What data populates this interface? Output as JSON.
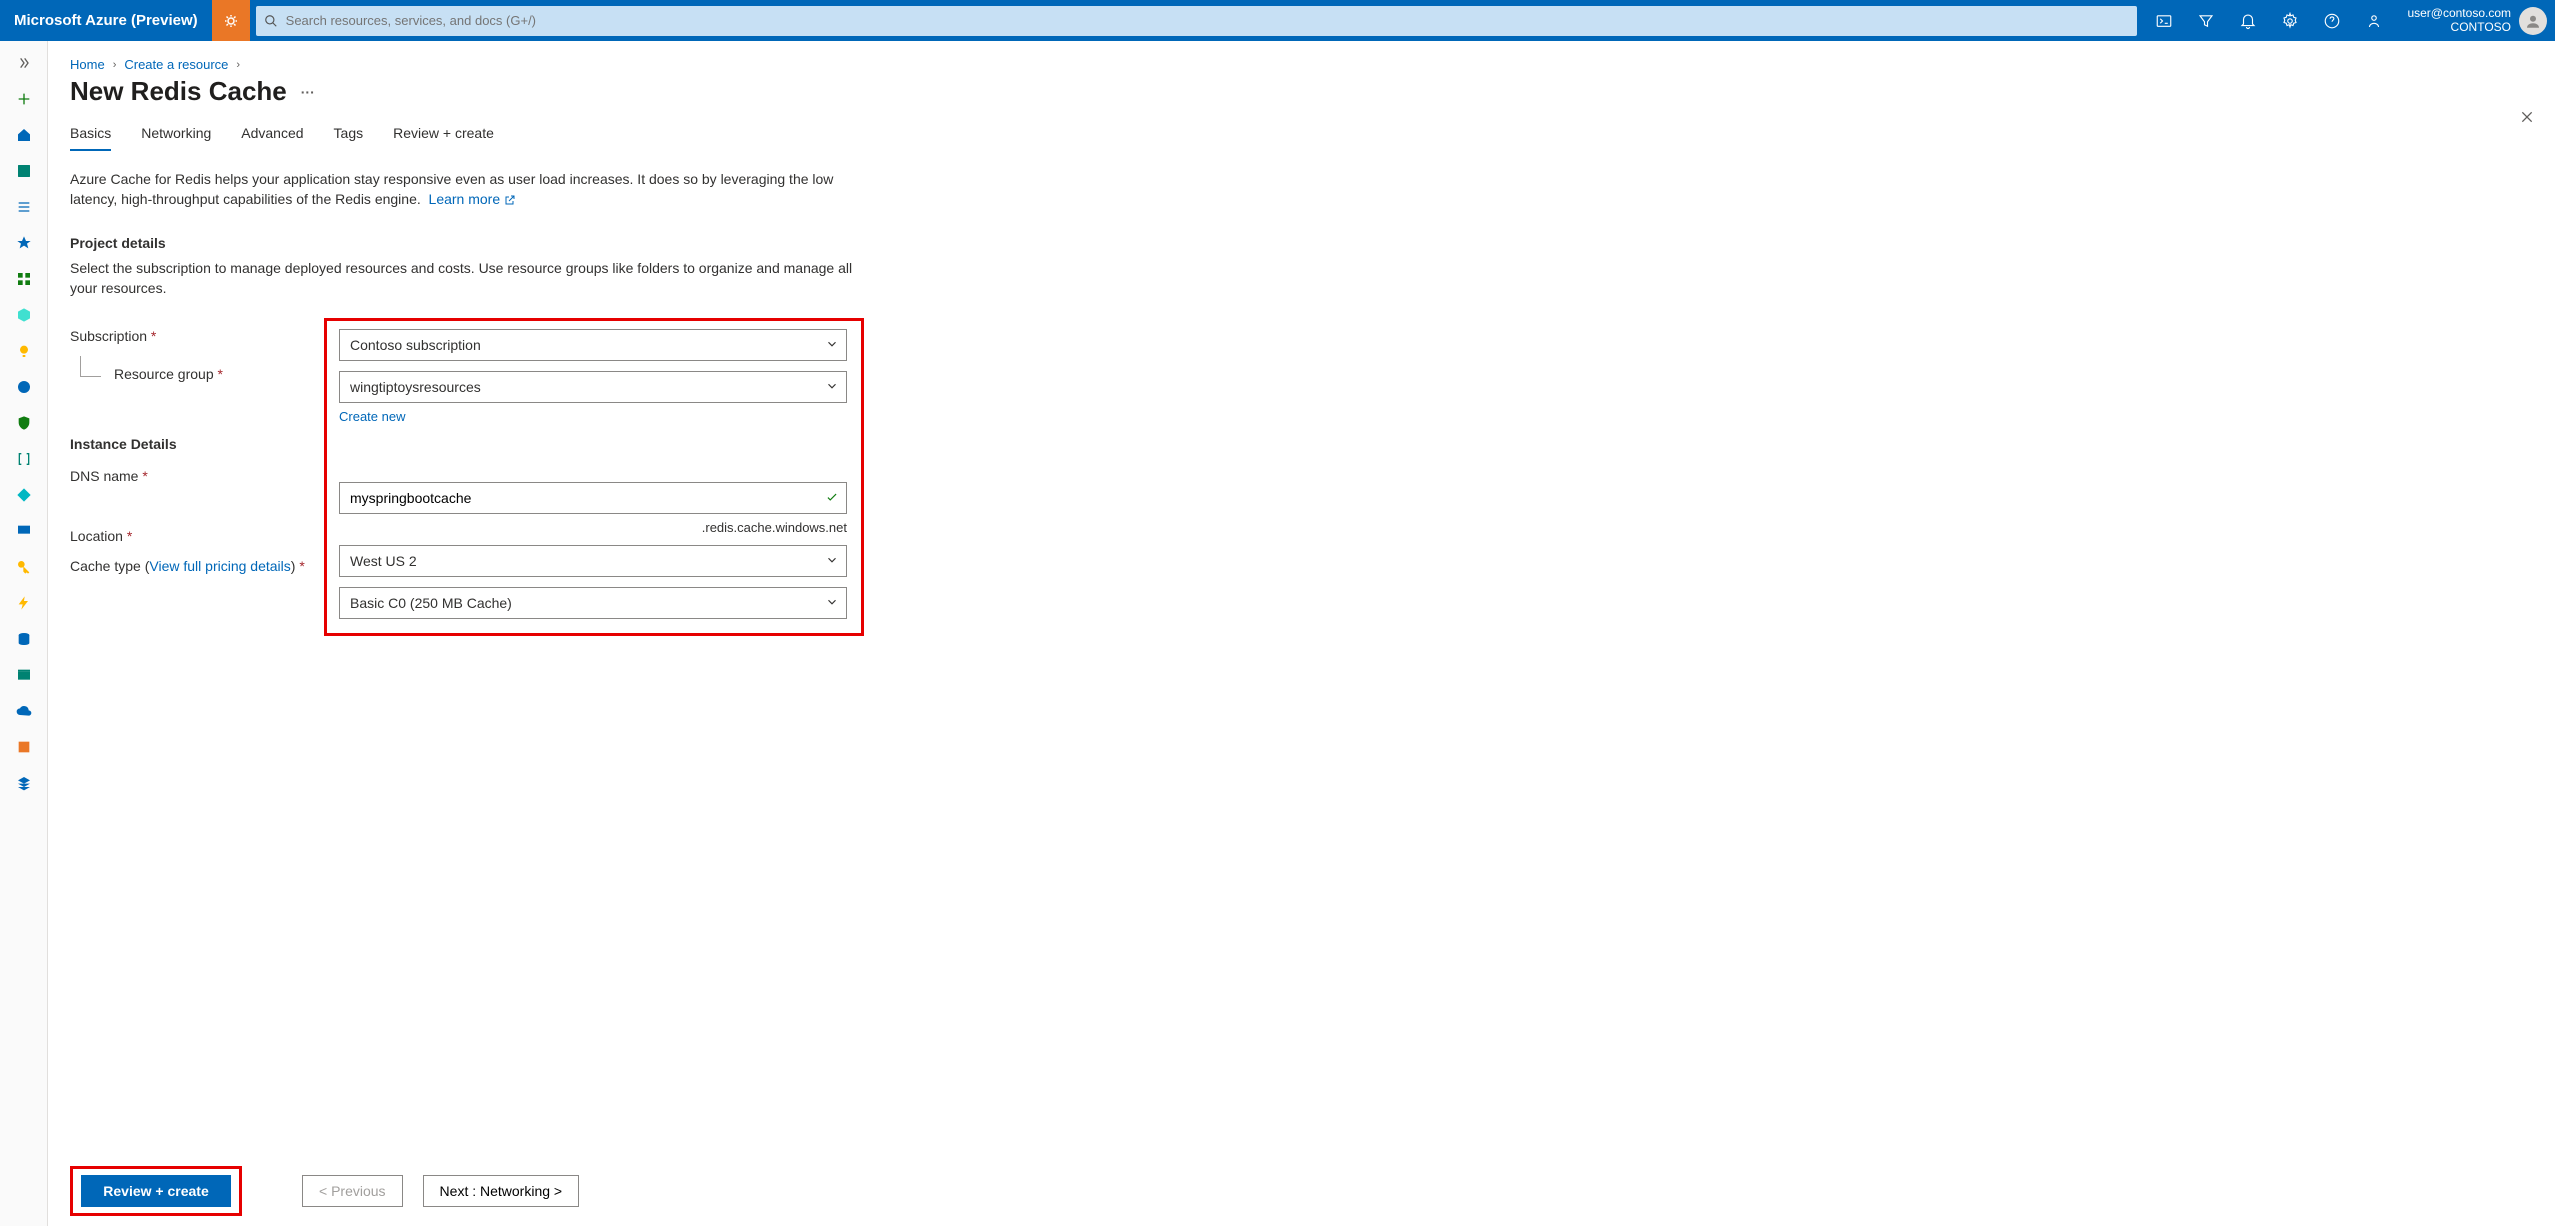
{
  "header": {
    "brand": "Microsoft Azure (Preview)",
    "search_placeholder": "Search resources, services, and docs (G+/)",
    "user_email": "user@contoso.com",
    "tenant": "CONTOSO"
  },
  "breadcrumb": {
    "home": "Home",
    "create": "Create a resource"
  },
  "page": {
    "title": "New Redis Cache",
    "more": "···"
  },
  "tabs": {
    "basics": "Basics",
    "networking": "Networking",
    "advanced": "Advanced",
    "tags": "Tags",
    "review": "Review + create"
  },
  "intro": {
    "text": "Azure Cache for Redis helps your application stay responsive even as user load increases. It does so by leveraging the low latency, high-throughput capabilities of the Redis engine.",
    "learn_more": "Learn more"
  },
  "project": {
    "heading": "Project details",
    "sub": "Select the subscription to manage deployed resources and costs. Use resource groups like folders to organize and manage all your resources.",
    "subscription_label": "Subscription",
    "subscription_value": "Contoso subscription",
    "rg_label": "Resource group",
    "rg_value": "wingtiptoysresources",
    "create_new": "Create new"
  },
  "instance": {
    "heading": "Instance Details",
    "dns_label": "DNS name",
    "dns_value": "myspringbootcache",
    "dns_suffix": ".redis.cache.windows.net",
    "location_label": "Location",
    "location_value": "West US 2",
    "cache_type_label": "Cache type",
    "pricing_link": "View full pricing details",
    "cache_type_value": "Basic C0 (250 MB Cache)"
  },
  "footer": {
    "review": "Review + create",
    "previous": "< Previous",
    "next": "Next : Networking >"
  }
}
